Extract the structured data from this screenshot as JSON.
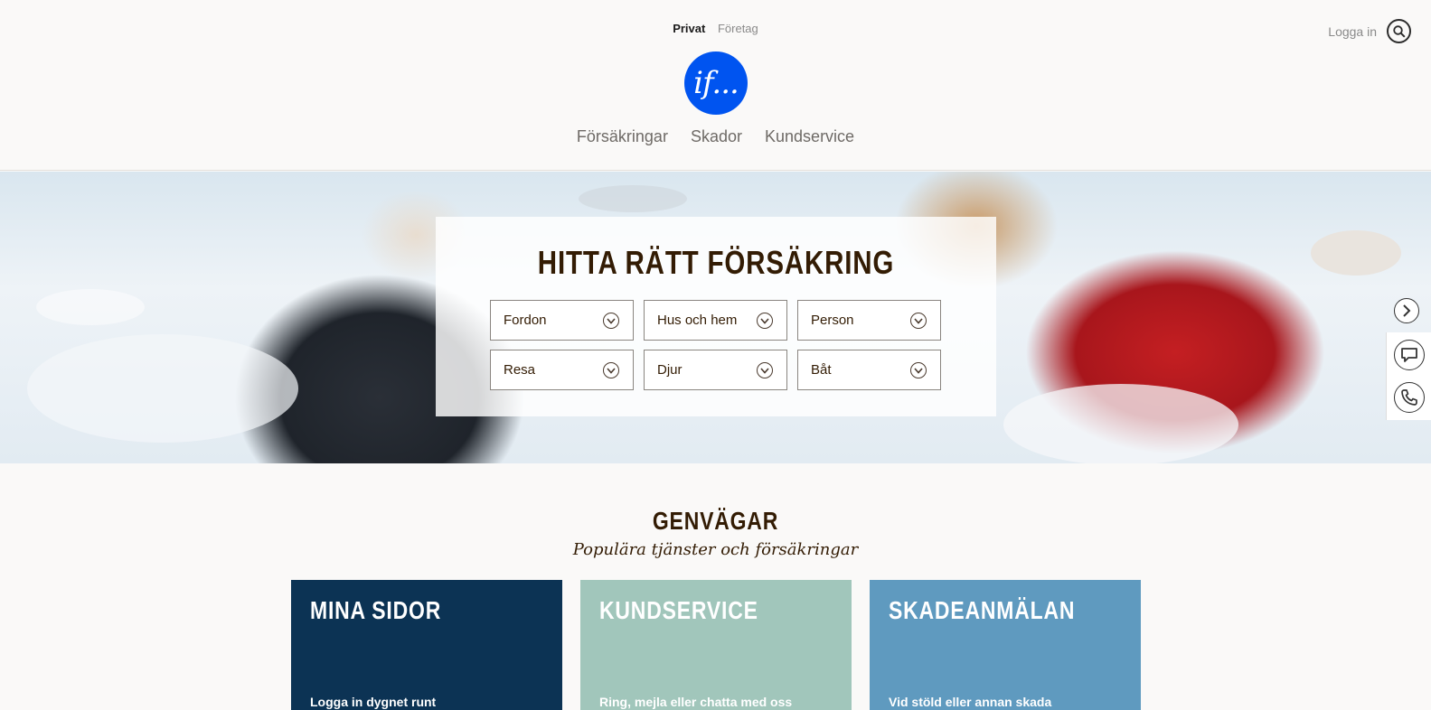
{
  "header": {
    "segments": {
      "private": "Privat",
      "business": "Företag"
    },
    "logo_text": "if...",
    "nav": [
      "Försäkringar",
      "Skador",
      "Kundservice"
    ],
    "login": "Logga in"
  },
  "hero": {
    "title": "HITTA RÄTT FÖRSÄKRING",
    "dropdowns": [
      "Fordon",
      "Hus och hem",
      "Person",
      "Resa",
      "Djur",
      "Båt"
    ]
  },
  "shortcuts": {
    "title": "GENVÄGAR",
    "subtitle": "Populära tjänster och försäkringar",
    "cards": [
      {
        "title": "MINA SIDOR",
        "text": "Logga in dygnet runt",
        "color": "#0c3354"
      },
      {
        "title": "KUNDSERVICE",
        "text": "Ring, mejla eller chatta med oss",
        "color": "#a1c6bb"
      },
      {
        "title": "SKADEANMÄLAN",
        "text": "Vid stöld eller annan skada",
        "color": "#5f9abf"
      }
    ]
  },
  "colors": {
    "brand": "#0054f0",
    "text": "#331c04"
  }
}
